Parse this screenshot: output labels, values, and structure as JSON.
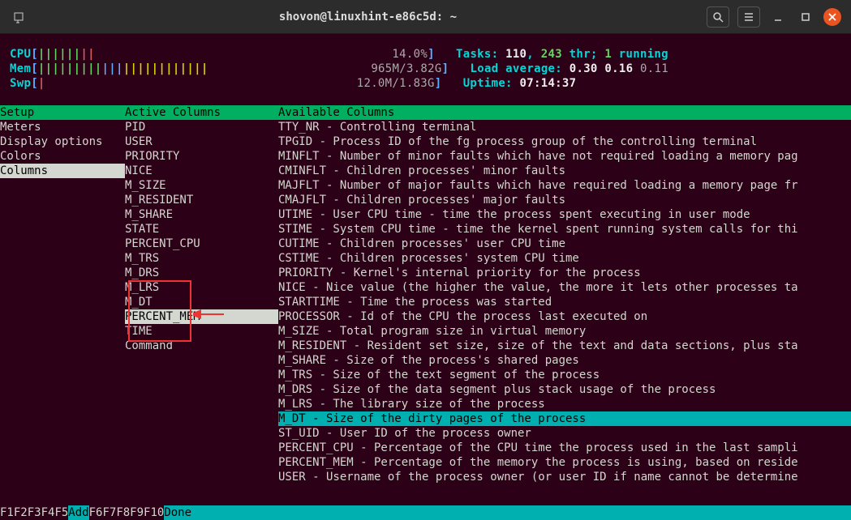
{
  "titlebar": {
    "title": "shovon@linuxhint-e86c5d: ~"
  },
  "meters": {
    "cpu_label": "CPU",
    "cpu_pct": "14.0%",
    "mem_label": "Mem",
    "mem_val": "965M/3.82G",
    "swp_label": "Swp",
    "swp_val": "12.0M/1.83G"
  },
  "summary": {
    "tasks": "Tasks: ",
    "tasks_n1": "110",
    "tasks_comma": ", ",
    "tasks_n2": "243",
    "tasks_thr": " thr; ",
    "tasks_n3": "1",
    "tasks_run": " running",
    "load": "Load average: ",
    "load1": "0.30",
    "load2": "0.16",
    "load3": "0.11",
    "uptime": "Uptime: ",
    "uptime_v": "07:14:37"
  },
  "panels": {
    "setup": {
      "header": "Setup",
      "items": [
        "Meters",
        "Display options",
        "Colors",
        "Columns"
      ],
      "selected": "Columns"
    },
    "active": {
      "header": "Active Columns",
      "items": [
        "PID",
        "USER",
        "PRIORITY",
        "NICE",
        "M_SIZE",
        "M_RESIDENT",
        "M_SHARE",
        "STATE",
        "PERCENT_CPU",
        "M_TRS",
        "M_DRS",
        "M_LRS",
        "M_DT",
        "PERCENT_MEM",
        "TIME",
        "Command"
      ],
      "selected": "PERCENT_MEM",
      "boxed": [
        "M_TRS",
        "M_DRS",
        "M_LRS",
        "M_DT"
      ]
    },
    "available": {
      "header": "Available Columns",
      "items": [
        "TTY_NR - Controlling terminal",
        "TPGID - Process ID of the fg process group of the controlling terminal",
        "MINFLT - Number of minor faults which have not required loading a memory pag",
        "CMINFLT - Children processes' minor faults",
        "MAJFLT - Number of major faults which have required loading a memory page fr",
        "CMAJFLT - Children processes' major faults",
        "UTIME - User CPU time - time the process spent executing in user mode",
        "STIME - System CPU time - time the kernel spent running system calls for thi",
        "CUTIME - Children processes' user CPU time",
        "CSTIME - Children processes' system CPU time",
        "PRIORITY - Kernel's internal priority for the process",
        "NICE - Nice value (the higher the value, the more it lets other processes ta",
        "STARTTIME - Time the process was started",
        "PROCESSOR - Id of the CPU the process last executed on",
        "M_SIZE - Total program size in virtual memory",
        "M_RESIDENT - Resident set size, size of the text and data sections, plus sta",
        "M_SHARE - Size of the process's shared pages",
        "M_TRS - Size of the text segment of the process",
        "M_DRS - Size of the data segment plus stack usage of the process",
        "M_LRS - The library size of the process",
        "M_DT - Size of the dirty pages of the process",
        "ST_UID - User ID of the process owner",
        "PERCENT_CPU - Percentage of the CPU time the process used in the last sampli",
        "PERCENT_MEM - Percentage of the memory the process is using, based on reside",
        "USER - Username of the process owner (or user ID if name cannot be determine"
      ],
      "selected_index": 20
    }
  },
  "fkeys": {
    "f1": "F1",
    "l1": "      ",
    "f2": "F2",
    "l2": "      ",
    "f3": "F3",
    "l3": "      ",
    "f4": "F4",
    "l4": "      ",
    "f5": "F5",
    "l5": "Add   ",
    "f6": "F6",
    "l6": "      ",
    "f7": "F7",
    "l7": "      ",
    "f8": "F8",
    "l8": "      ",
    "f9": "F9",
    "l9": "      ",
    "f10": "F10",
    "l10": "Done  "
  }
}
